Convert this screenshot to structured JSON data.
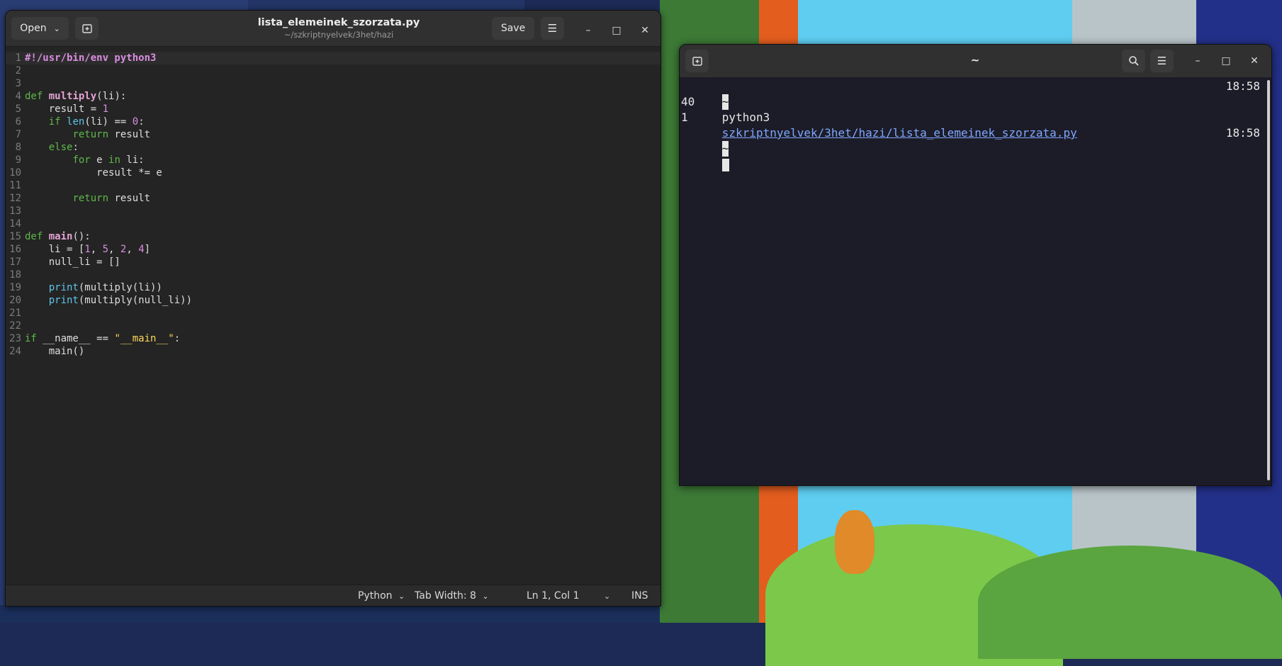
{
  "editor": {
    "open_label": "Open",
    "save_label": "Save",
    "title": "lista_elemeinek_szorzata.py",
    "subtitle": "~/szkriptnyelvek/3het/hazi",
    "lines": [
      {
        "n": "1",
        "text": "#!/usr/bin/env python3"
      },
      {
        "n": "2",
        "text": ""
      },
      {
        "n": "3",
        "text": ""
      },
      {
        "n": "4",
        "text": "def multiply(li):"
      },
      {
        "n": "5",
        "text": "    result = 1"
      },
      {
        "n": "6",
        "text": "    if len(li) == 0:"
      },
      {
        "n": "7",
        "text": "        return result"
      },
      {
        "n": "8",
        "text": "    else:"
      },
      {
        "n": "9",
        "text": "        for e in li:"
      },
      {
        "n": "10",
        "text": "            result *= e"
      },
      {
        "n": "11",
        "text": ""
      },
      {
        "n": "12",
        "text": "        return result"
      },
      {
        "n": "13",
        "text": ""
      },
      {
        "n": "14",
        "text": ""
      },
      {
        "n": "15",
        "text": "def main():"
      },
      {
        "n": "16",
        "text": "    li = [1, 5, 2, 4]"
      },
      {
        "n": "17",
        "text": "    null_li = []"
      },
      {
        "n": "18",
        "text": ""
      },
      {
        "n": "19",
        "text": "    print(multiply(li))"
      },
      {
        "n": "20",
        "text": "    print(multiply(null_li))"
      },
      {
        "n": "21",
        "text": ""
      },
      {
        "n": "22",
        "text": ""
      },
      {
        "n": "23",
        "text": "if __name__ == \"__main__\":"
      },
      {
        "n": "24",
        "text": "    main()"
      }
    ],
    "status": {
      "language": "Python",
      "tab_width": "Tab Width: 8",
      "position": "Ln 1, Col 1",
      "mode": "INS"
    }
  },
  "terminal": {
    "title": "~",
    "prompt": "~",
    "command": "python3",
    "script_path": "szkriptnyelvek/3het/hazi/lista_elemeinek_szorzata.py",
    "output_lines": [
      "40",
      "1"
    ],
    "time_1": "18:58",
    "time_2": "18:58"
  },
  "colors": {
    "keyword": "#5fb84a",
    "function_name": "#e4a3d4",
    "builtin": "#5fc3e8",
    "number": "#d98de0",
    "string": "#ffd85a",
    "link": "#7fa7ff"
  }
}
